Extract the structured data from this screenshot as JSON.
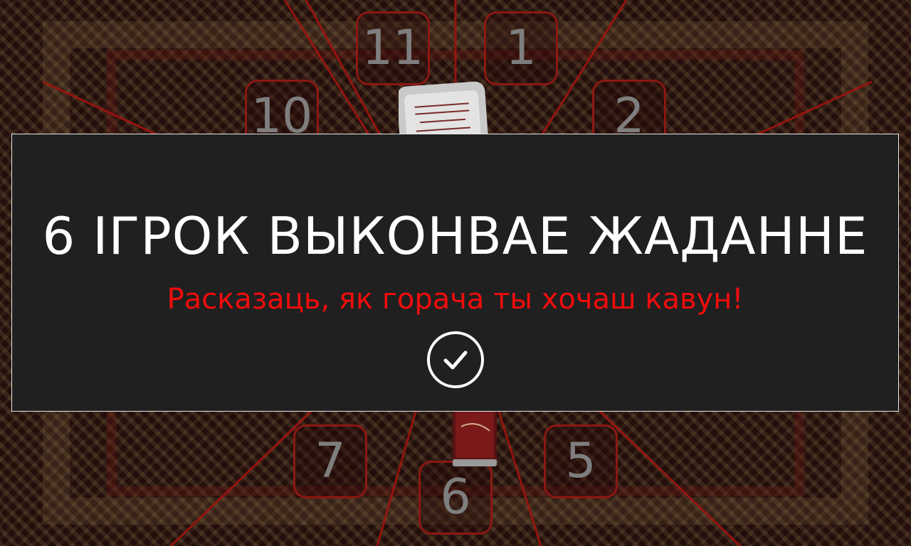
{
  "wheel": {
    "slots": [
      {
        "id": "slot-1",
        "label": "1"
      },
      {
        "id": "slot-2",
        "label": "2"
      },
      {
        "id": "slot-5",
        "label": "5"
      },
      {
        "id": "slot-6",
        "label": "6"
      },
      {
        "id": "slot-7",
        "label": "7"
      },
      {
        "id": "slot-10",
        "label": "10"
      },
      {
        "id": "slot-11",
        "label": "11"
      }
    ],
    "line_color": "#a0140e",
    "slot_border_color": "#8c1812"
  },
  "dialog": {
    "title": "6 ІГРОК ВЫКОНВАЕ ЖАДАННЕ",
    "task": "Расказаць, як горача ты хочаш кавун!",
    "task_color": "#f20c0c",
    "confirm_icon": "checkmark-icon"
  }
}
